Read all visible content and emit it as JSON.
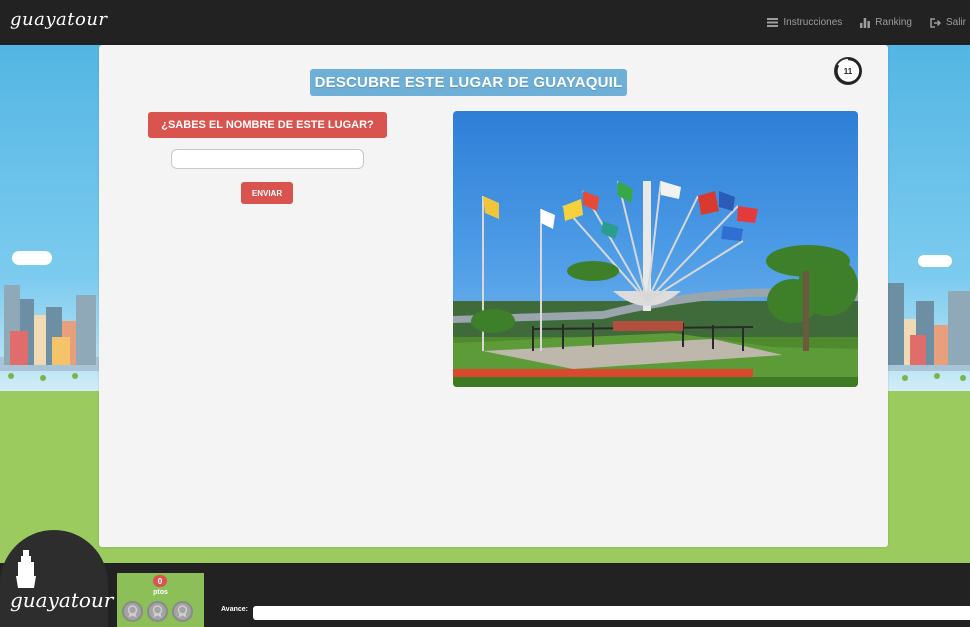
{
  "app": {
    "logo_text": "guayatour",
    "footer_logo_text": "guayatour"
  },
  "nav": [
    {
      "label": "Instrucciones",
      "icon": "list-icon"
    },
    {
      "label": "Ranking",
      "icon": "bar-chart-icon"
    },
    {
      "label": "Salir",
      "icon": "logout-icon"
    }
  ],
  "game": {
    "title": "DESCUBRE ESTE LUGAR DE GUAYAQUIL",
    "timer": "11",
    "question": "¿SABES EL NOMBRE DE ESTE LUGAR?",
    "answer_value": "",
    "answer_placeholder": "",
    "submit_label": "ENVIAR",
    "photo_icon": "flags-monument-photo"
  },
  "score": {
    "points": "0",
    "unit": "ptos",
    "medals": [
      "medal-icon",
      "medal-icon",
      "medal-icon"
    ]
  },
  "progress": {
    "label": "Avance:",
    "value": 0
  },
  "colors": {
    "accent_red": "#d9534f",
    "title_blue": "#6dafd6",
    "grass": "#9bcb5e",
    "dark": "#222222"
  }
}
